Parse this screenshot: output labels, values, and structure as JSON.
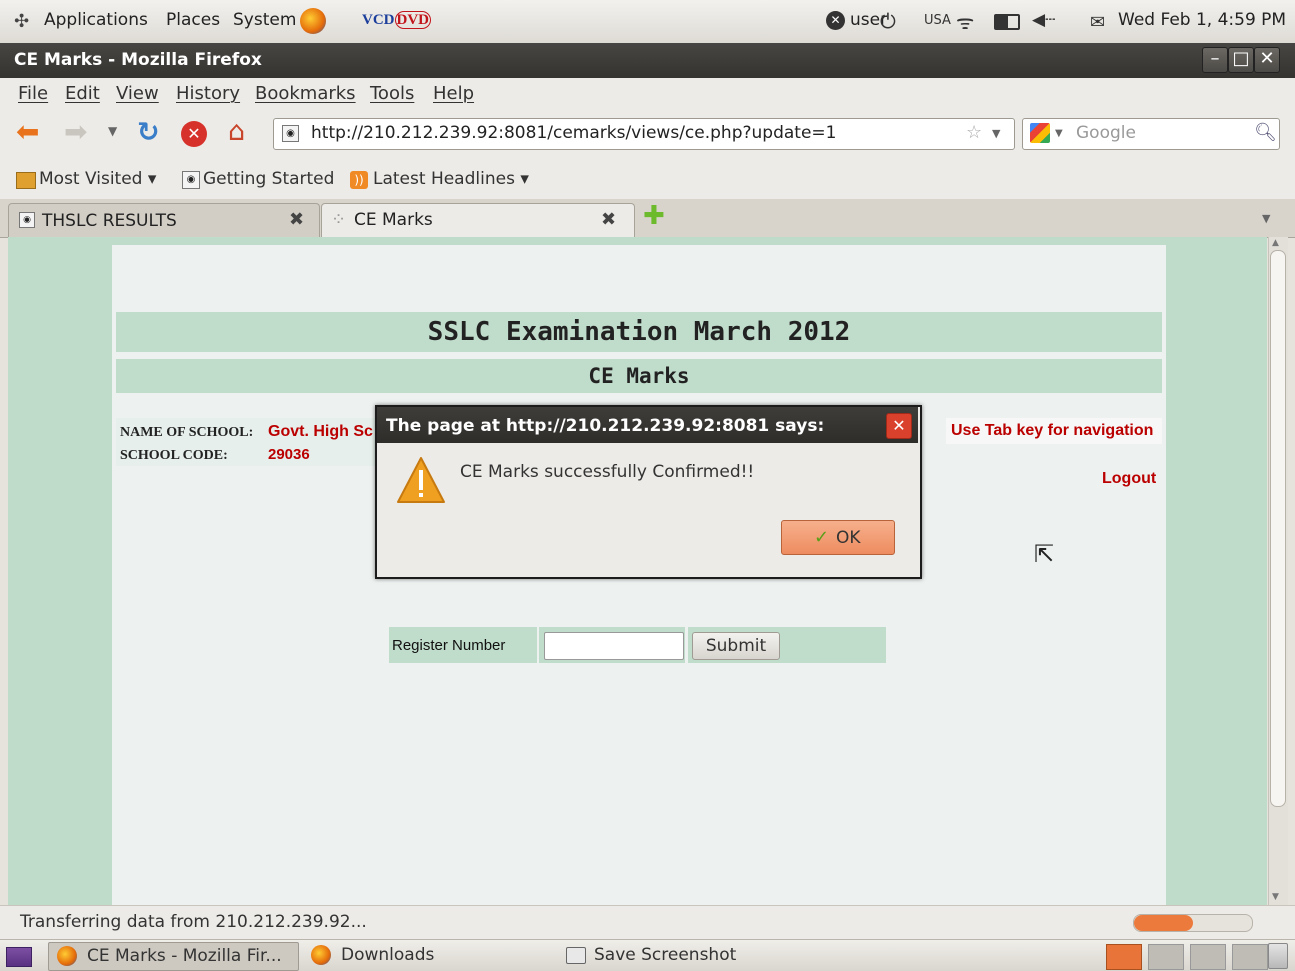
{
  "panel_top": {
    "applications": "Applications",
    "places": "Places",
    "system": "System",
    "vcd": "VCD",
    "dvd": "DVD",
    "user": "user",
    "keyboard": "USA",
    "datetime": "Wed Feb 1, 4:59 PM"
  },
  "window": {
    "title": "CE Marks - Mozilla Firefox"
  },
  "menu": [
    "File",
    "Edit",
    "View",
    "History",
    "Bookmarks",
    "Tools",
    "Help"
  ],
  "toolbar": {
    "url": "http://210.212.239.92:8081/cemarks/views/ce.php?update=1",
    "search_placeholder": "Google"
  },
  "bookmarks": [
    "Most Visited ▾",
    "Getting Started",
    "Latest Headlines ▾"
  ],
  "tabs": [
    {
      "label": "THSLC RESULTS"
    },
    {
      "label": "CE Marks"
    }
  ],
  "page": {
    "heading": "SSLC Examination March 2012",
    "subheading": "CE Marks",
    "school_name_label": "NAME OF SCHOOL:",
    "school_name_value": "Govt. High Sc",
    "school_code_label": "SCHOOL CODE:",
    "school_code_value": "29036",
    "nav_hint": "Use Tab key for navigation",
    "logout": "Logout",
    "register_label": "Register Number",
    "register_value": "",
    "submit": "Submit"
  },
  "dialog": {
    "title": "The page at http://210.212.239.92:8081 says:",
    "message": "CE Marks successfully Confirmed!!",
    "ok": "OK"
  },
  "status": {
    "text": "Transferring data from 210.212.239.92...",
    "progress": 0.5
  },
  "taskbar": [
    "CE Marks - Mozilla Fir...",
    "Downloads",
    "Save Screenshot"
  ],
  "colors": {
    "page_bg": "#bfdccb",
    "band": "#c0dccb",
    "link_red": "#b00000",
    "ok_button": "#f09a72"
  }
}
